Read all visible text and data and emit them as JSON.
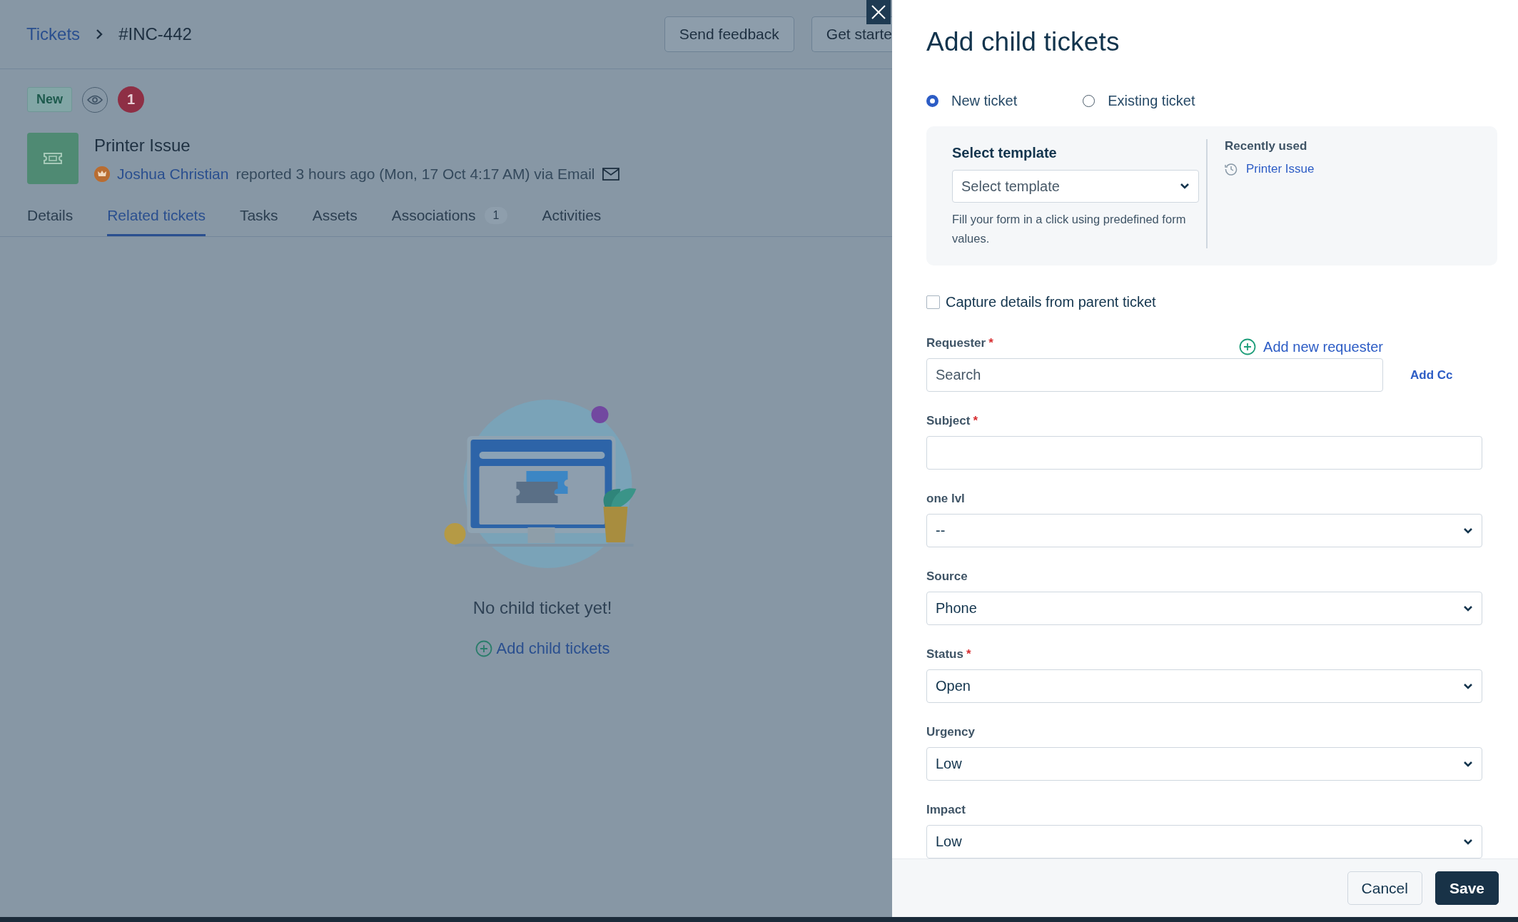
{
  "header": {
    "breadcrumb": [
      {
        "label": "Tickets",
        "kind": "link"
      },
      {
        "label": "#INC-442",
        "kind": "current"
      }
    ],
    "buttons": [
      "Send feedback",
      "Get starte"
    ]
  },
  "ticket": {
    "status_tag": "New",
    "watcher_count": "1",
    "title": "Printer Issue",
    "requester": "Joshua Christian",
    "meta": "reported 3 hours ago (Mon, 17 Oct 4:17 AM) via Email"
  },
  "tabs": [
    {
      "label": "Details",
      "selected": false
    },
    {
      "label": "Related tickets",
      "selected": true
    },
    {
      "label": "Tasks",
      "selected": false
    },
    {
      "label": "Assets",
      "selected": false
    },
    {
      "label": "Associations",
      "selected": false,
      "count": "1"
    },
    {
      "label": "Activities",
      "selected": false
    }
  ],
  "empty_state": {
    "message": "No child ticket yet!",
    "action": "Add child tickets"
  },
  "panel": {
    "title": "Add child tickets",
    "required_mark": "*",
    "modes": [
      {
        "label": "New ticket",
        "selected": true
      },
      {
        "label": "Existing ticket",
        "selected": false
      }
    ],
    "template": {
      "label": "Select template",
      "value": "Select template",
      "help": "Fill your form in a click using predefined form values.",
      "recent_label": "Recently used",
      "recent_items": [
        "Printer Issue"
      ]
    },
    "capture": {
      "label": "Capture details from parent ticket",
      "checked": false
    },
    "requester": {
      "label": "Requester",
      "required": true,
      "placeholder": "Search",
      "add_new": "Add new requester",
      "add_cc": "Add Cc"
    },
    "fields": [
      {
        "label": "Subject",
        "required": true,
        "kind": "text"
      },
      {
        "label": "one lvl",
        "required": false,
        "kind": "select",
        "value": "--"
      },
      {
        "label": "Source",
        "required": false,
        "kind": "select",
        "value": "Phone"
      },
      {
        "label": "Status",
        "required": true,
        "kind": "select",
        "value": "Open"
      },
      {
        "label": "Urgency",
        "required": false,
        "kind": "select",
        "value": "Low"
      },
      {
        "label": "Impact",
        "required": false,
        "kind": "select",
        "value": "Low"
      }
    ],
    "buttons": [
      {
        "label": "Cancel",
        "kind": "secondary"
      },
      {
        "label": "Save",
        "kind": "primary"
      }
    ]
  }
}
